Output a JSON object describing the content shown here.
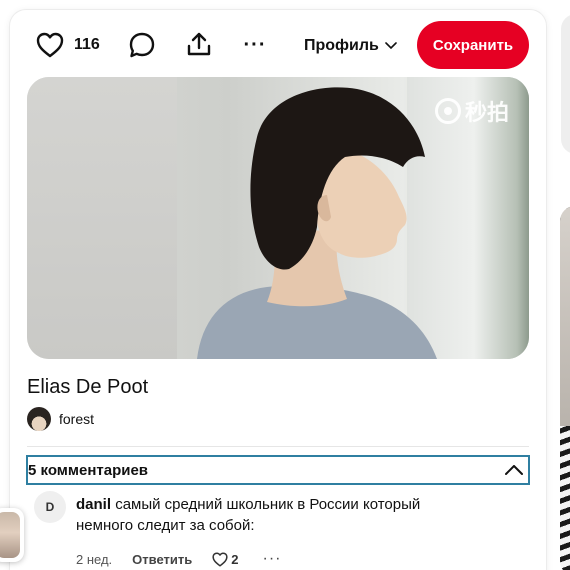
{
  "toolbar": {
    "like_count": "116",
    "profile_label": "Профиль",
    "save_label": "Сохранить",
    "more_glyph": "···",
    "icons": [
      "heart-icon",
      "comment-icon",
      "share-icon",
      "more-icon",
      "chevron-down-icon"
    ]
  },
  "media": {
    "watermark_text": "秒拍"
  },
  "pin": {
    "title": "Elias De Poot",
    "author": "forest"
  },
  "comments": {
    "count_label": "5 комментариев",
    "items": [
      {
        "avatar_letter": "D",
        "user": "danil",
        "text": "самый средний школьник в России который немного следит за собой:",
        "time": "2 нед.",
        "reply_label": "Ответить",
        "likes": "2",
        "more_glyph": "···"
      }
    ]
  },
  "colors": {
    "save_button": "#e60023",
    "focus_outline": "#2f7fa1",
    "text": "#111111"
  }
}
